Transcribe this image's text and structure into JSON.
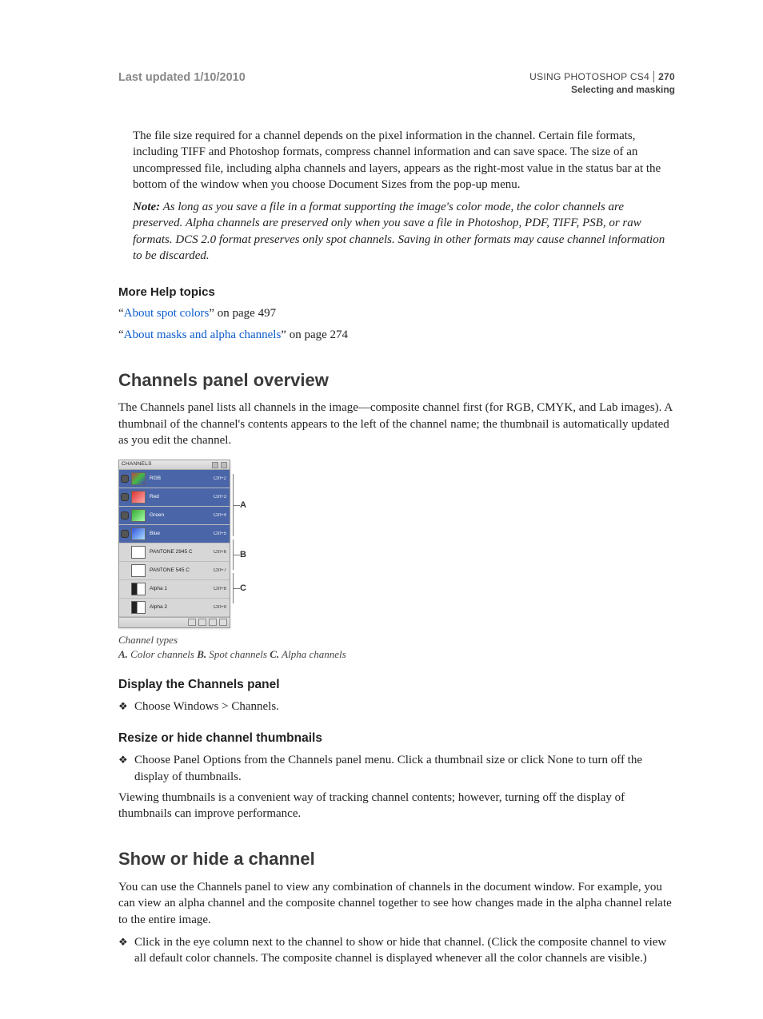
{
  "header": {
    "last_updated": "Last updated 1/10/2010",
    "doc_title": "USING PHOTOSHOP CS4",
    "section": "Selecting and masking",
    "page_number": "270"
  },
  "body": {
    "p1": "The file size required for a channel depends on the pixel information in the channel. Certain file formats, including TIFF and Photoshop formats, compress channel information and can save space. The size of an uncompressed file, including alpha channels and layers, appears as the right-most value in the status bar at the bottom of the window when you choose Document Sizes from the pop-up menu.",
    "note_label": "Note:",
    "note": " As long as you save a file in a format supporting the image's color mode, the color channels are preserved. Alpha channels are preserved only when you save a file in Photoshop, PDF, TIFF, PSB, or raw formats. DCS 2.0 format preserves only spot channels. Saving in other formats may cause channel information to be discarded."
  },
  "more_help": {
    "heading": "More Help topics",
    "link1_q1": "“",
    "link1_text": "About spot colors",
    "link1_rest": "” on page 497",
    "link2_q1": "“",
    "link2_text": "About masks and alpha channels",
    "link2_rest": "” on page 274"
  },
  "sec1": {
    "heading": "Channels panel overview",
    "p1": "The Channels panel lists all channels in the image—composite channel first (for RGB, CMYK, and Lab images). A thumbnail of the channel's contents appears to the left of the channel name; the thumbnail is automatically updated as you edit the channel."
  },
  "panel": {
    "title": "CHANNELS",
    "rows": [
      {
        "name": "RGB",
        "shortcut": "Ctrl+2",
        "eye": true,
        "sel": true,
        "thumb": "rgb"
      },
      {
        "name": "Red",
        "shortcut": "Ctrl+3",
        "eye": true,
        "sel": true,
        "thumb": "red"
      },
      {
        "name": "Green",
        "shortcut": "Ctrl+4",
        "eye": true,
        "sel": true,
        "thumb": "green"
      },
      {
        "name": "Blue",
        "shortcut": "Ctrl+5",
        "eye": true,
        "sel": true,
        "thumb": "blue"
      },
      {
        "name": "PANTONE 2945 C",
        "shortcut": "Ctrl+6",
        "eye": false,
        "sel": false,
        "thumb": "spot"
      },
      {
        "name": "PANTONE 545 C",
        "shortcut": "Ctrl+7",
        "eye": false,
        "sel": false,
        "thumb": "spot"
      },
      {
        "name": "Alpha 1",
        "shortcut": "Ctrl+8",
        "eye": false,
        "sel": false,
        "thumb": "alpha"
      },
      {
        "name": "Alpha 2",
        "shortcut": "Ctrl+9",
        "eye": false,
        "sel": false,
        "thumb": "alpha"
      }
    ],
    "callouts": {
      "A": "A",
      "B": "B",
      "C": "C"
    }
  },
  "caption": {
    "line1": "Channel types",
    "a_label": "A.",
    "a_text": " Color channels  ",
    "b_label": "B.",
    "b_text": " Spot channels  ",
    "c_label": "C.",
    "c_text": " Alpha channels"
  },
  "sub1": {
    "heading": "Display the Channels panel",
    "bullet": "Choose Windows > Channels."
  },
  "sub2": {
    "heading": "Resize or hide channel thumbnails",
    "bullet": "Choose Panel Options from the Channels panel menu. Click a thumbnail size or click None to turn off the display of thumbnails.",
    "p": "Viewing thumbnails is a convenient way of tracking channel contents; however, turning off the display of thumbnails can improve performance."
  },
  "sec2": {
    "heading": "Show or hide a channel",
    "p1": "You can use the Channels panel to view any combination of channels in the document window. For example, you can view an alpha channel and the composite channel together to see how changes made in the alpha channel relate to the entire image.",
    "bullet": "Click in the eye column next to the channel to show or hide that channel. (Click the composite channel to view all default color channels. The composite channel is displayed whenever all the color channels are visible.)"
  },
  "glyphs": {
    "diamond": "❖"
  }
}
